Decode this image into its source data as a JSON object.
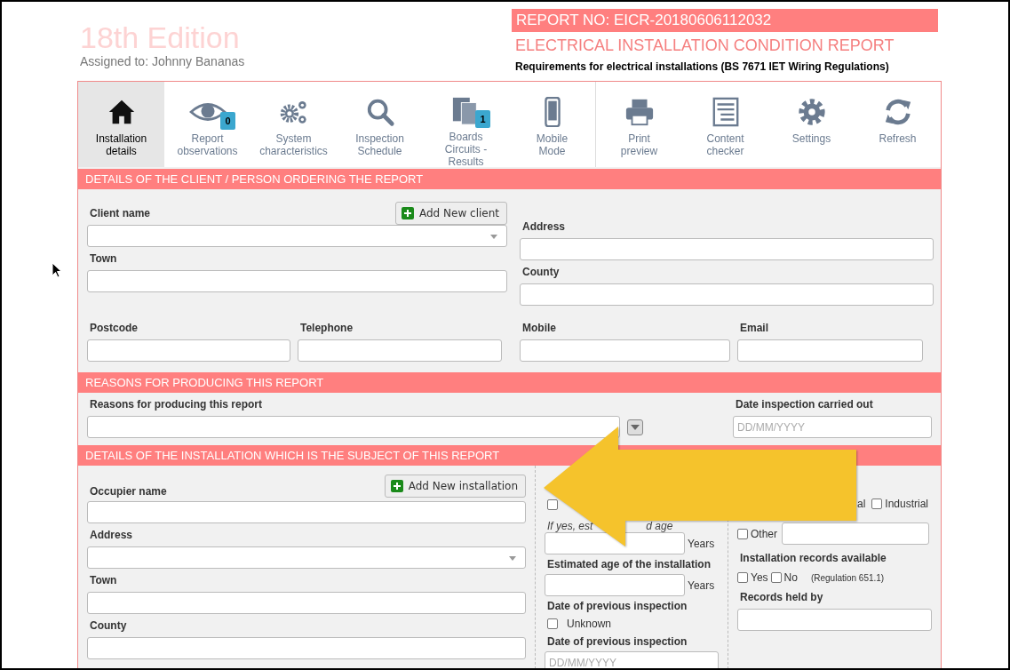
{
  "header": {
    "edition": "18th Edition",
    "assigned": "Assigned to: Johnny Bananas",
    "report_no": "REPORT NO: EICR-20180606112032",
    "report_title": "ELECTRICAL INSTALLATION CONDITION REPORT",
    "subtitle": "Requirements for electrical installations (BS 7671 IET Wiring Regulations)"
  },
  "toolbar": {
    "main": [
      {
        "kind": "home",
        "lines": [
          "Installation",
          "details"
        ],
        "selected": true
      },
      {
        "kind": "eye",
        "lines": [
          "Report",
          "observations"
        ],
        "badge": "0",
        "selected": false
      },
      {
        "kind": "gears",
        "lines": [
          "System",
          "characteristics"
        ],
        "selected": false
      },
      {
        "kind": "search",
        "lines": [
          "Inspection",
          "Schedule"
        ],
        "selected": false
      },
      {
        "kind": "boards",
        "lines": [
          "Boards",
          "Circuits -",
          "Results"
        ],
        "badge": "1",
        "selected": false
      },
      {
        "kind": "mobile",
        "lines": [
          "Mobile",
          "Mode"
        ],
        "selected": false
      }
    ],
    "tools": [
      {
        "kind": "printer",
        "lines": [
          "Print",
          "preview"
        ]
      },
      {
        "kind": "checker",
        "lines": [
          "Content",
          "checker"
        ]
      },
      {
        "kind": "gear",
        "lines": [
          "Settings"
        ]
      },
      {
        "kind": "refresh",
        "lines": [
          "Refresh"
        ]
      }
    ]
  },
  "client": {
    "title": "DETAILS OF THE CLIENT / PERSON ORDERING THE REPORT",
    "client_name": "Client name",
    "add_button": "Add New client",
    "town": "Town",
    "address": "Address",
    "county": "County",
    "postcode": "Postcode",
    "telephone": "Telephone",
    "mobile": "Mobile",
    "email": "Email"
  },
  "reasons": {
    "title": "REASONS FOR PRODUCING THIS REPORT",
    "reasons_label": "Reasons for producing this report",
    "date_label": "Date inspection carried out",
    "date_placeholder": "DD/MM/YYYY"
  },
  "installation": {
    "title": "DETAILS OF THE INSTALLATION WHICH IS THE SUBJECT OF THIS REPORT",
    "occupier": "Occupier name",
    "add_button": "Add New installation",
    "address": "Address",
    "town": "Town",
    "county": "County",
    "middle": {
      "checkbox": {
        "checked": false
      },
      "hint_start": "If yes, est",
      "hint_end": "d age",
      "years_1": "Years",
      "estimated_age": "Estimated age of the installation",
      "years_2": "Years",
      "previous_1": "Date of previous inspection",
      "unknown": {
        "label": "Unknown",
        "checked": false
      },
      "previous_2": "Date of previous inspection",
      "date_placeholder": "DD/MM/YYYY"
    },
    "right": {
      "type_fragment": "al",
      "type_options": [
        {
          "label": "Industrial",
          "checked": false
        }
      ],
      "other": {
        "label": "Other",
        "checked": false
      },
      "records_label": "Installation records available",
      "records_options": [
        {
          "label": "Yes",
          "checked": false
        },
        {
          "label": "No",
          "checked": false
        }
      ],
      "regulation": "(Regulation 651.1)",
      "held_by": "Records held by"
    }
  }
}
